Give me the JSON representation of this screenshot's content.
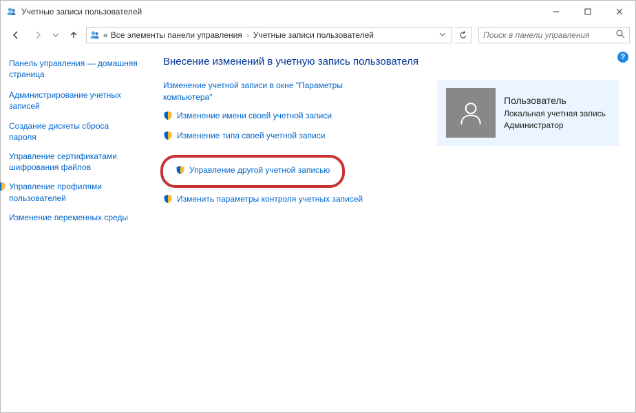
{
  "window": {
    "title": "Учетные записи пользователей"
  },
  "breadcrumb": {
    "prefix": "«",
    "item1": "Все элементы панели управления",
    "item2": "Учетные записи пользователей"
  },
  "search": {
    "placeholder": "Поиск в панели управления"
  },
  "sidebar": {
    "home": "Панель управления — домашняя страница",
    "link1": "Администрирование учетных записей",
    "link2": "Создание дискеты сброса пароля",
    "link3": "Управление сертификатами шифрования файлов",
    "link4": "Управление профилями пользователей",
    "link5": "Изменение переменных среды"
  },
  "main": {
    "heading": "Внесение изменений в учетную запись пользователя",
    "action1": "Изменение учетной записи в окне \"Параметры компьютера\"",
    "action2": "Изменение имени своей учетной записи",
    "action3": "Изменение типа своей учетной записи",
    "action4": "Управление другой учетной записью",
    "action5": "Изменить параметры контроля учетных записей"
  },
  "user": {
    "name": "Пользователь",
    "type": "Локальная учетная запись",
    "role": "Администратор"
  }
}
